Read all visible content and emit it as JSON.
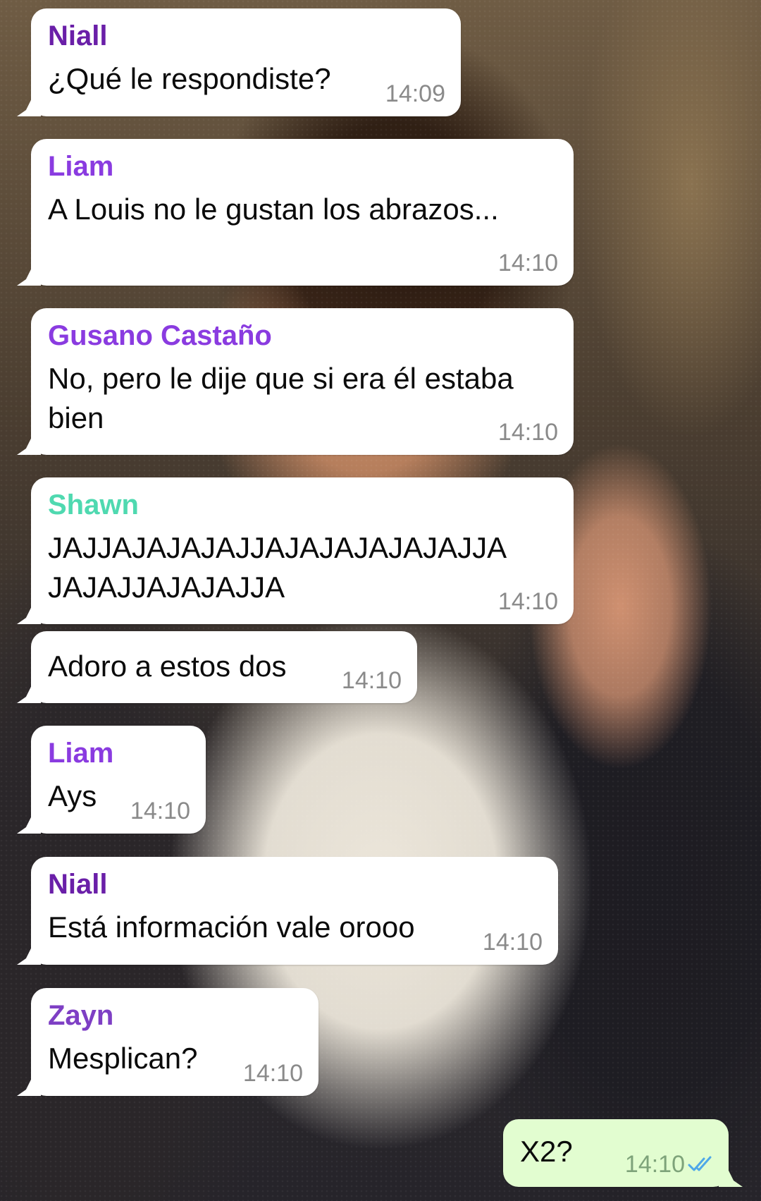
{
  "colors": {
    "niall": "#6a1fa8",
    "liam": "#8a3be0",
    "gusano": "#8a3be0",
    "shawn": "#4fd9b0",
    "zayn": "#7e3fc4",
    "incoming_bubble": "#ffffff",
    "outgoing_bubble": "#e2fdd0",
    "read_ticks": "#4fa8e8"
  },
  "messages": [
    {
      "sender": "Niall",
      "text": "¿Qué le respondiste?",
      "time": "14:09"
    },
    {
      "sender": "Liam",
      "text": "A Louis no le gustan los abrazos...",
      "time": "14:10"
    },
    {
      "sender": "Gusano Castaño",
      "text": "No, pero le dije que si era él estaba bien",
      "time": "14:10"
    },
    {
      "sender": "Shawn",
      "text": "JAJJAJAJAJAJJAJAJAJAJAJAJJA JAJAJJAJAJAJJA",
      "time": "14:10"
    },
    {
      "sender": "",
      "text": "Adoro a estos dos",
      "time": "14:10"
    },
    {
      "sender": "Liam",
      "text": "Ays",
      "time": "14:10"
    },
    {
      "sender": "Niall",
      "text": "Está información vale orooo",
      "time": "14:10"
    },
    {
      "sender": "Zayn",
      "text": "Mesplican?",
      "time": "14:10"
    },
    {
      "sender": "",
      "text": "X2?",
      "time": "14:10",
      "outgoing": true,
      "status_icon": "double-check-read-icon"
    }
  ]
}
